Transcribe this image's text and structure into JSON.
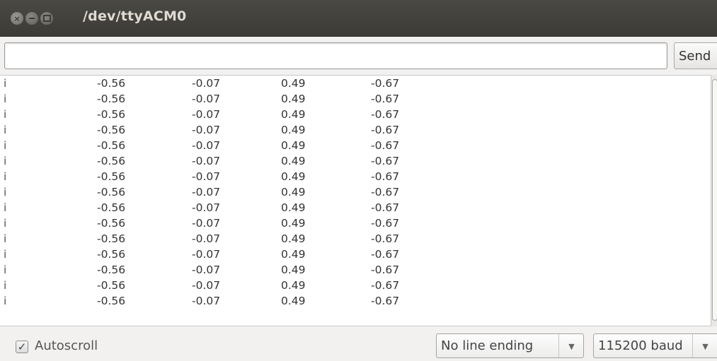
{
  "window": {
    "title": "/dev/ttyACM0"
  },
  "send": {
    "input_value": "",
    "button_label": "Send"
  },
  "output": {
    "rows": [
      [
        "i",
        "-0.56",
        "-0.07",
        "0.49",
        "-0.67"
      ],
      [
        "i",
        "-0.56",
        "-0.07",
        "0.49",
        "-0.67"
      ],
      [
        "i",
        "-0.56",
        "-0.07",
        "0.49",
        "-0.67"
      ],
      [
        "i",
        "-0.56",
        "-0.07",
        "0.49",
        "-0.67"
      ],
      [
        "i",
        "-0.56",
        "-0.07",
        "0.49",
        "-0.67"
      ],
      [
        "i",
        "-0.56",
        "-0.07",
        "0.49",
        "-0.67"
      ],
      [
        "i",
        "-0.56",
        "-0.07",
        "0.49",
        "-0.67"
      ],
      [
        "i",
        "-0.56",
        "-0.07",
        "0.49",
        "-0.67"
      ],
      [
        "i",
        "-0.56",
        "-0.07",
        "0.49",
        "-0.67"
      ],
      [
        "i",
        "-0.56",
        "-0.07",
        "0.49",
        "-0.67"
      ],
      [
        "i",
        "-0.56",
        "-0.07",
        "0.49",
        "-0.67"
      ],
      [
        "i",
        "-0.56",
        "-0.07",
        "0.49",
        "-0.67"
      ],
      [
        "i",
        "-0.56",
        "-0.07",
        "0.49",
        "-0.67"
      ],
      [
        "i",
        "-0.56",
        "-0.07",
        "0.49",
        "-0.67"
      ],
      [
        "i",
        "-0.56",
        "-0.07",
        "0.49",
        "-0.67"
      ]
    ]
  },
  "footer": {
    "autoscroll_label": "Autoscroll",
    "autoscroll_checked": true,
    "line_ending_value": "No line ending",
    "baud_value": "115200 baud"
  },
  "icons": {
    "close": "close-icon",
    "minimize": "minimize-icon",
    "maximize": "maximize-icon",
    "checkbox": "checkbox-icon",
    "dropdown": "chevron-down-icon"
  },
  "colors": {
    "titlebar": "#3c3b37",
    "title_text": "#dfdbd2",
    "window_bg": "#f2f1f0"
  }
}
